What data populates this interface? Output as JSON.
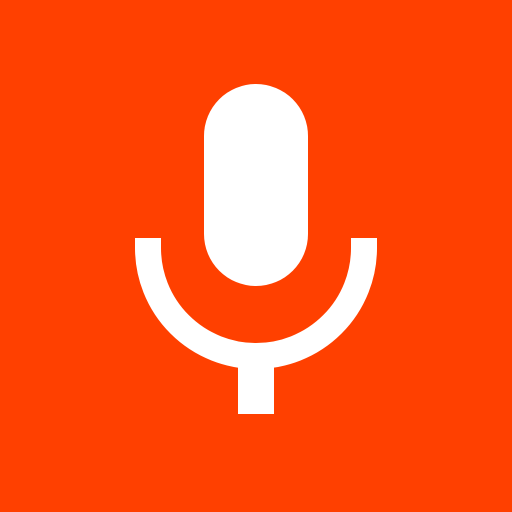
{
  "app": {
    "icon": "microphone-icon",
    "background_color": "#FF4000",
    "foreground_color": "#FFFFFF"
  }
}
